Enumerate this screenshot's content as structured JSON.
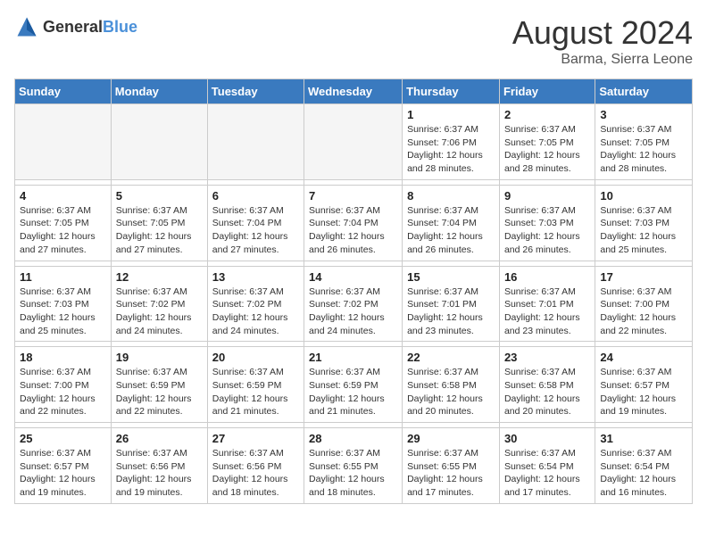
{
  "header": {
    "logo_general": "General",
    "logo_blue": "Blue",
    "month_year": "August 2024",
    "location": "Barma, Sierra Leone"
  },
  "days_of_week": [
    "Sunday",
    "Monday",
    "Tuesday",
    "Wednesday",
    "Thursday",
    "Friday",
    "Saturday"
  ],
  "weeks": [
    [
      {
        "day": "",
        "info": ""
      },
      {
        "day": "",
        "info": ""
      },
      {
        "day": "",
        "info": ""
      },
      {
        "day": "",
        "info": ""
      },
      {
        "day": "1",
        "info": "Sunrise: 6:37 AM\nSunset: 7:06 PM\nDaylight: 12 hours\nand 28 minutes."
      },
      {
        "day": "2",
        "info": "Sunrise: 6:37 AM\nSunset: 7:05 PM\nDaylight: 12 hours\nand 28 minutes."
      },
      {
        "day": "3",
        "info": "Sunrise: 6:37 AM\nSunset: 7:05 PM\nDaylight: 12 hours\nand 28 minutes."
      }
    ],
    [
      {
        "day": "4",
        "info": "Sunrise: 6:37 AM\nSunset: 7:05 PM\nDaylight: 12 hours\nand 27 minutes."
      },
      {
        "day": "5",
        "info": "Sunrise: 6:37 AM\nSunset: 7:05 PM\nDaylight: 12 hours\nand 27 minutes."
      },
      {
        "day": "6",
        "info": "Sunrise: 6:37 AM\nSunset: 7:04 PM\nDaylight: 12 hours\nand 27 minutes."
      },
      {
        "day": "7",
        "info": "Sunrise: 6:37 AM\nSunset: 7:04 PM\nDaylight: 12 hours\nand 26 minutes."
      },
      {
        "day": "8",
        "info": "Sunrise: 6:37 AM\nSunset: 7:04 PM\nDaylight: 12 hours\nand 26 minutes."
      },
      {
        "day": "9",
        "info": "Sunrise: 6:37 AM\nSunset: 7:03 PM\nDaylight: 12 hours\nand 26 minutes."
      },
      {
        "day": "10",
        "info": "Sunrise: 6:37 AM\nSunset: 7:03 PM\nDaylight: 12 hours\nand 25 minutes."
      }
    ],
    [
      {
        "day": "11",
        "info": "Sunrise: 6:37 AM\nSunset: 7:03 PM\nDaylight: 12 hours\nand 25 minutes."
      },
      {
        "day": "12",
        "info": "Sunrise: 6:37 AM\nSunset: 7:02 PM\nDaylight: 12 hours\nand 24 minutes."
      },
      {
        "day": "13",
        "info": "Sunrise: 6:37 AM\nSunset: 7:02 PM\nDaylight: 12 hours\nand 24 minutes."
      },
      {
        "day": "14",
        "info": "Sunrise: 6:37 AM\nSunset: 7:02 PM\nDaylight: 12 hours\nand 24 minutes."
      },
      {
        "day": "15",
        "info": "Sunrise: 6:37 AM\nSunset: 7:01 PM\nDaylight: 12 hours\nand 23 minutes."
      },
      {
        "day": "16",
        "info": "Sunrise: 6:37 AM\nSunset: 7:01 PM\nDaylight: 12 hours\nand 23 minutes."
      },
      {
        "day": "17",
        "info": "Sunrise: 6:37 AM\nSunset: 7:00 PM\nDaylight: 12 hours\nand 22 minutes."
      }
    ],
    [
      {
        "day": "18",
        "info": "Sunrise: 6:37 AM\nSunset: 7:00 PM\nDaylight: 12 hours\nand 22 minutes."
      },
      {
        "day": "19",
        "info": "Sunrise: 6:37 AM\nSunset: 6:59 PM\nDaylight: 12 hours\nand 22 minutes."
      },
      {
        "day": "20",
        "info": "Sunrise: 6:37 AM\nSunset: 6:59 PM\nDaylight: 12 hours\nand 21 minutes."
      },
      {
        "day": "21",
        "info": "Sunrise: 6:37 AM\nSunset: 6:59 PM\nDaylight: 12 hours\nand 21 minutes."
      },
      {
        "day": "22",
        "info": "Sunrise: 6:37 AM\nSunset: 6:58 PM\nDaylight: 12 hours\nand 20 minutes."
      },
      {
        "day": "23",
        "info": "Sunrise: 6:37 AM\nSunset: 6:58 PM\nDaylight: 12 hours\nand 20 minutes."
      },
      {
        "day": "24",
        "info": "Sunrise: 6:37 AM\nSunset: 6:57 PM\nDaylight: 12 hours\nand 19 minutes."
      }
    ],
    [
      {
        "day": "25",
        "info": "Sunrise: 6:37 AM\nSunset: 6:57 PM\nDaylight: 12 hours\nand 19 minutes."
      },
      {
        "day": "26",
        "info": "Sunrise: 6:37 AM\nSunset: 6:56 PM\nDaylight: 12 hours\nand 19 minutes."
      },
      {
        "day": "27",
        "info": "Sunrise: 6:37 AM\nSunset: 6:56 PM\nDaylight: 12 hours\nand 18 minutes."
      },
      {
        "day": "28",
        "info": "Sunrise: 6:37 AM\nSunset: 6:55 PM\nDaylight: 12 hours\nand 18 minutes."
      },
      {
        "day": "29",
        "info": "Sunrise: 6:37 AM\nSunset: 6:55 PM\nDaylight: 12 hours\nand 17 minutes."
      },
      {
        "day": "30",
        "info": "Sunrise: 6:37 AM\nSunset: 6:54 PM\nDaylight: 12 hours\nand 17 minutes."
      },
      {
        "day": "31",
        "info": "Sunrise: 6:37 AM\nSunset: 6:54 PM\nDaylight: 12 hours\nand 16 minutes."
      }
    ]
  ]
}
